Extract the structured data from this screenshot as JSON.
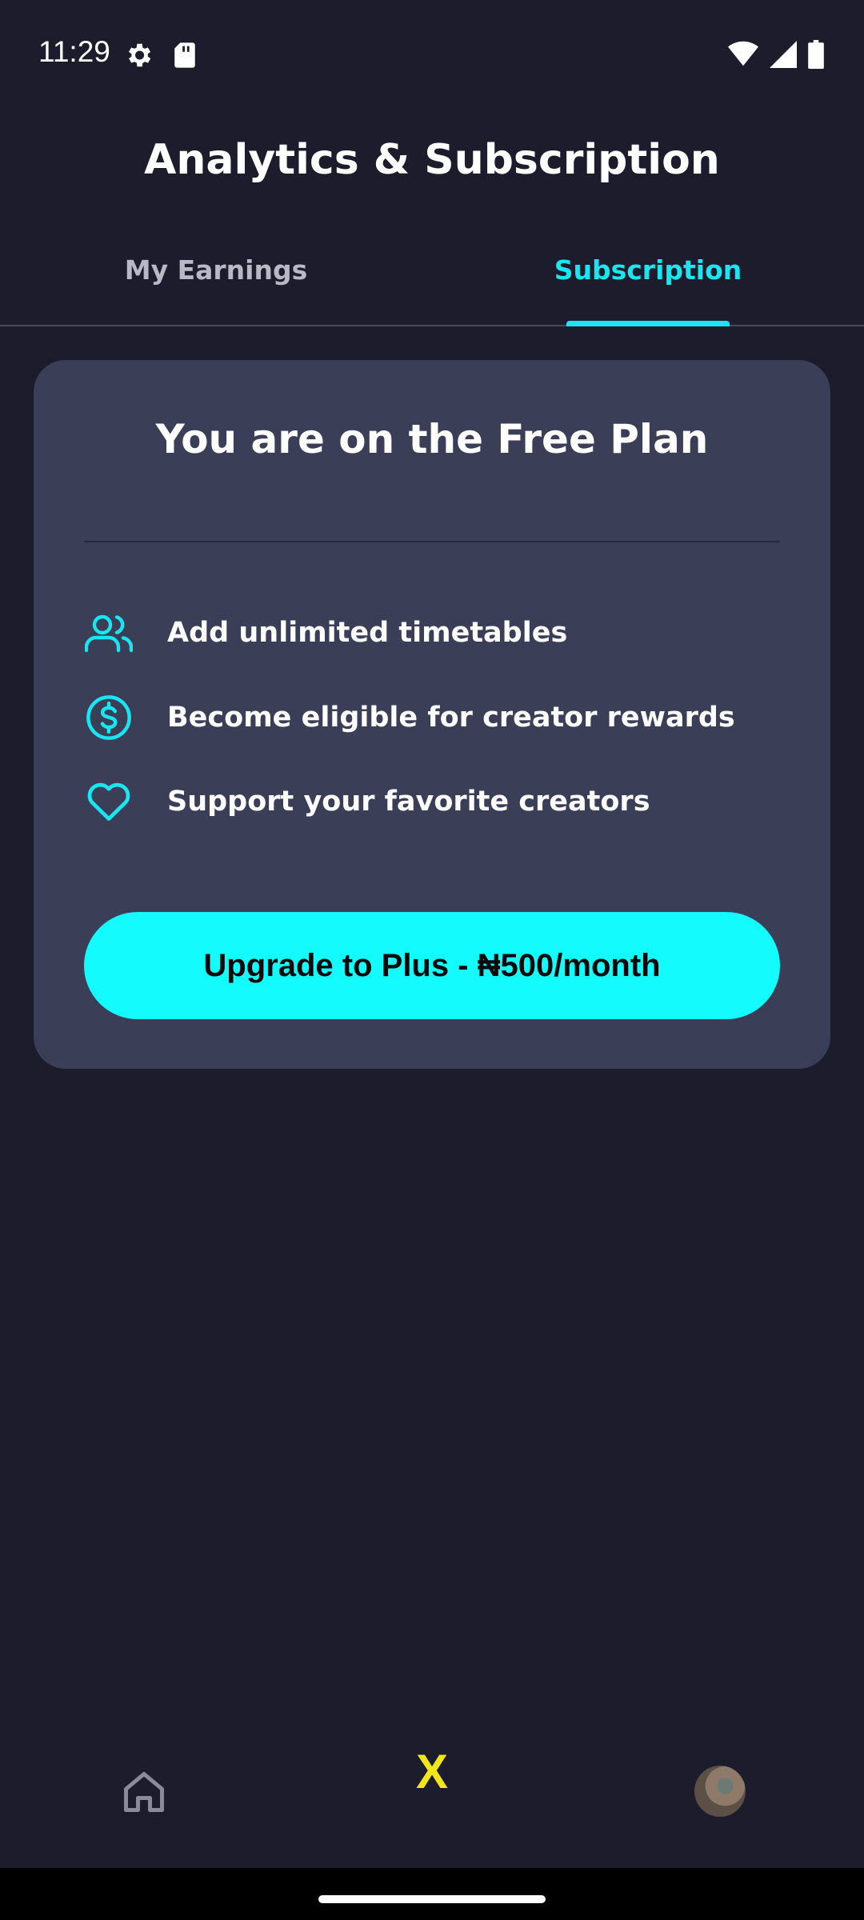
{
  "status_bar": {
    "time": "11:29",
    "icons": [
      "gear-icon",
      "sd-card-icon",
      "wifi-icon",
      "cell-signal-icon",
      "battery-icon"
    ]
  },
  "header": {
    "title": "Analytics & Subscription"
  },
  "tabs": [
    {
      "label": "My Earnings",
      "active": false
    },
    {
      "label": "Subscription",
      "active": true
    }
  ],
  "plan_card": {
    "title": "You are on the Free Plan",
    "features": [
      {
        "icon": "users-icon",
        "label": "Add unlimited timetables"
      },
      {
        "icon": "dollar-circle-icon",
        "label": "Become eligible for creator rewards"
      },
      {
        "icon": "heart-icon",
        "label": "Support your favorite creators"
      }
    ],
    "upgrade_button": "Upgrade to Plus - ₦500/month"
  },
  "bottom_nav": {
    "items": [
      {
        "icon": "home-icon"
      },
      {
        "icon": "x-logo-icon",
        "label": "X"
      },
      {
        "icon": "avatar"
      }
    ]
  },
  "colors": {
    "background": "#1c1c2c",
    "card": "#3a3e57",
    "accent": "#19e6f0",
    "button": "#14fbfd",
    "nav_x": "#f2e61a"
  }
}
